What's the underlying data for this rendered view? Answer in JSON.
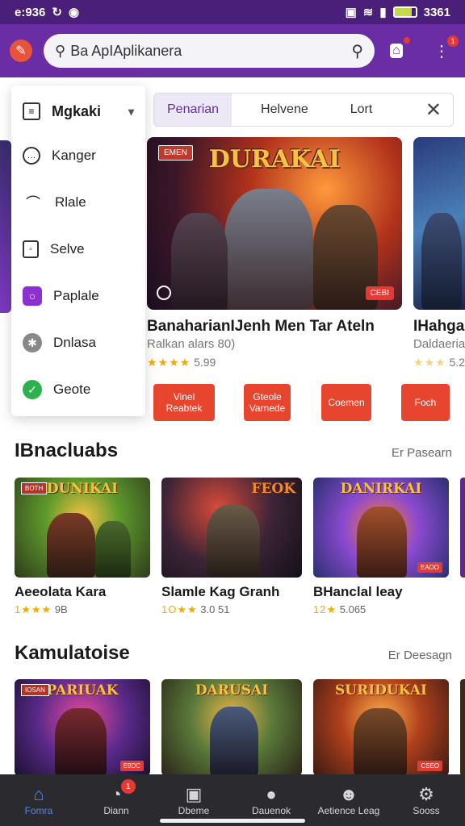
{
  "status": {
    "time": "e:936",
    "right": "3361",
    "icons": [
      "sim-icon",
      "wifi-icon",
      "signal-icon",
      "battery-icon"
    ]
  },
  "header": {
    "search_text": "Ba ApIAplikanera"
  },
  "colors": {
    "primary": "#6b2da3",
    "accent": "#e8452f",
    "nav_bg": "#2b2b2f",
    "star": "#f2a900"
  },
  "dropdown": {
    "title": "Mgkaki",
    "items": [
      {
        "label": "Kanger",
        "icon": "chat-icon"
      },
      {
        "label": "Rlale",
        "icon": "leaf-icon"
      },
      {
        "label": "Selve",
        "icon": "document-icon"
      },
      {
        "label": "Paplale",
        "icon": "circle-app-icon"
      },
      {
        "label": "Dnlasa",
        "icon": "settings-icon"
      },
      {
        "label": "Geote",
        "icon": "check-icon"
      }
    ]
  },
  "filters": {
    "tabs": [
      "Penarian",
      "Helvene",
      "Lort"
    ]
  },
  "featured": [
    {
      "art_title": "DURAKAI",
      "badge": "EMEN",
      "price": "CEBI",
      "title": "BanaharianIJenh Men Tar Ateln",
      "subtitle": "Ralkan alars 80)",
      "stars": "★★★★",
      "rating": "5.99"
    },
    {
      "art_title": "",
      "badge": "",
      "price": "",
      "title": "IHahgar",
      "subtitle": "Daldaeria",
      "stars": "★★★",
      "rating": "5.2"
    }
  ],
  "actions": [
    "Vinel Reabtek",
    "Gteole Varnede",
    "Coemen",
    "Foch"
  ],
  "sections": [
    {
      "title": "IBnacluabs",
      "more": "Er Pasearn",
      "games": [
        {
          "art_title": "DUNIKAI",
          "badge": "BOTH",
          "title": "Aeeolata Kara",
          "stars": "1★★★",
          "rating": "9B"
        },
        {
          "art_title": "FEOK",
          "badge": "",
          "title": "Slamle Kag Granh",
          "stars": "1O★★",
          "rating": "3.0 51"
        },
        {
          "art_title": "DANIRKAI",
          "badge": "",
          "price": "EAOO",
          "title": "BHanclal leay",
          "stars": "12★",
          "rating": "5.065"
        }
      ]
    },
    {
      "title": "Kamulatoise",
      "more": "Er Deesagn",
      "games": [
        {
          "art_title": "PARIUAK",
          "badge": "IOSAN",
          "price": "E9DC",
          "title": "",
          "stars": "",
          "rating": ""
        },
        {
          "art_title": "DARUSAI",
          "badge": "",
          "title": "",
          "stars": "",
          "rating": ""
        },
        {
          "art_title": "SURIDUKAI",
          "badge": "",
          "price": "CSEO",
          "title": "",
          "stars": "",
          "rating": ""
        }
      ]
    }
  ],
  "bottom_nav": [
    {
      "label": "Fomra",
      "icon": "home-icon",
      "active": true
    },
    {
      "label": "Diann",
      "icon": "explore-icon",
      "badge": "1"
    },
    {
      "label": "Dbeme",
      "icon": "camera-icon"
    },
    {
      "label": "Dauenok",
      "icon": "pin-icon"
    },
    {
      "label": "Aetience Leag",
      "icon": "user-icon"
    },
    {
      "label": "Sooss",
      "icon": "gear-icon"
    }
  ]
}
